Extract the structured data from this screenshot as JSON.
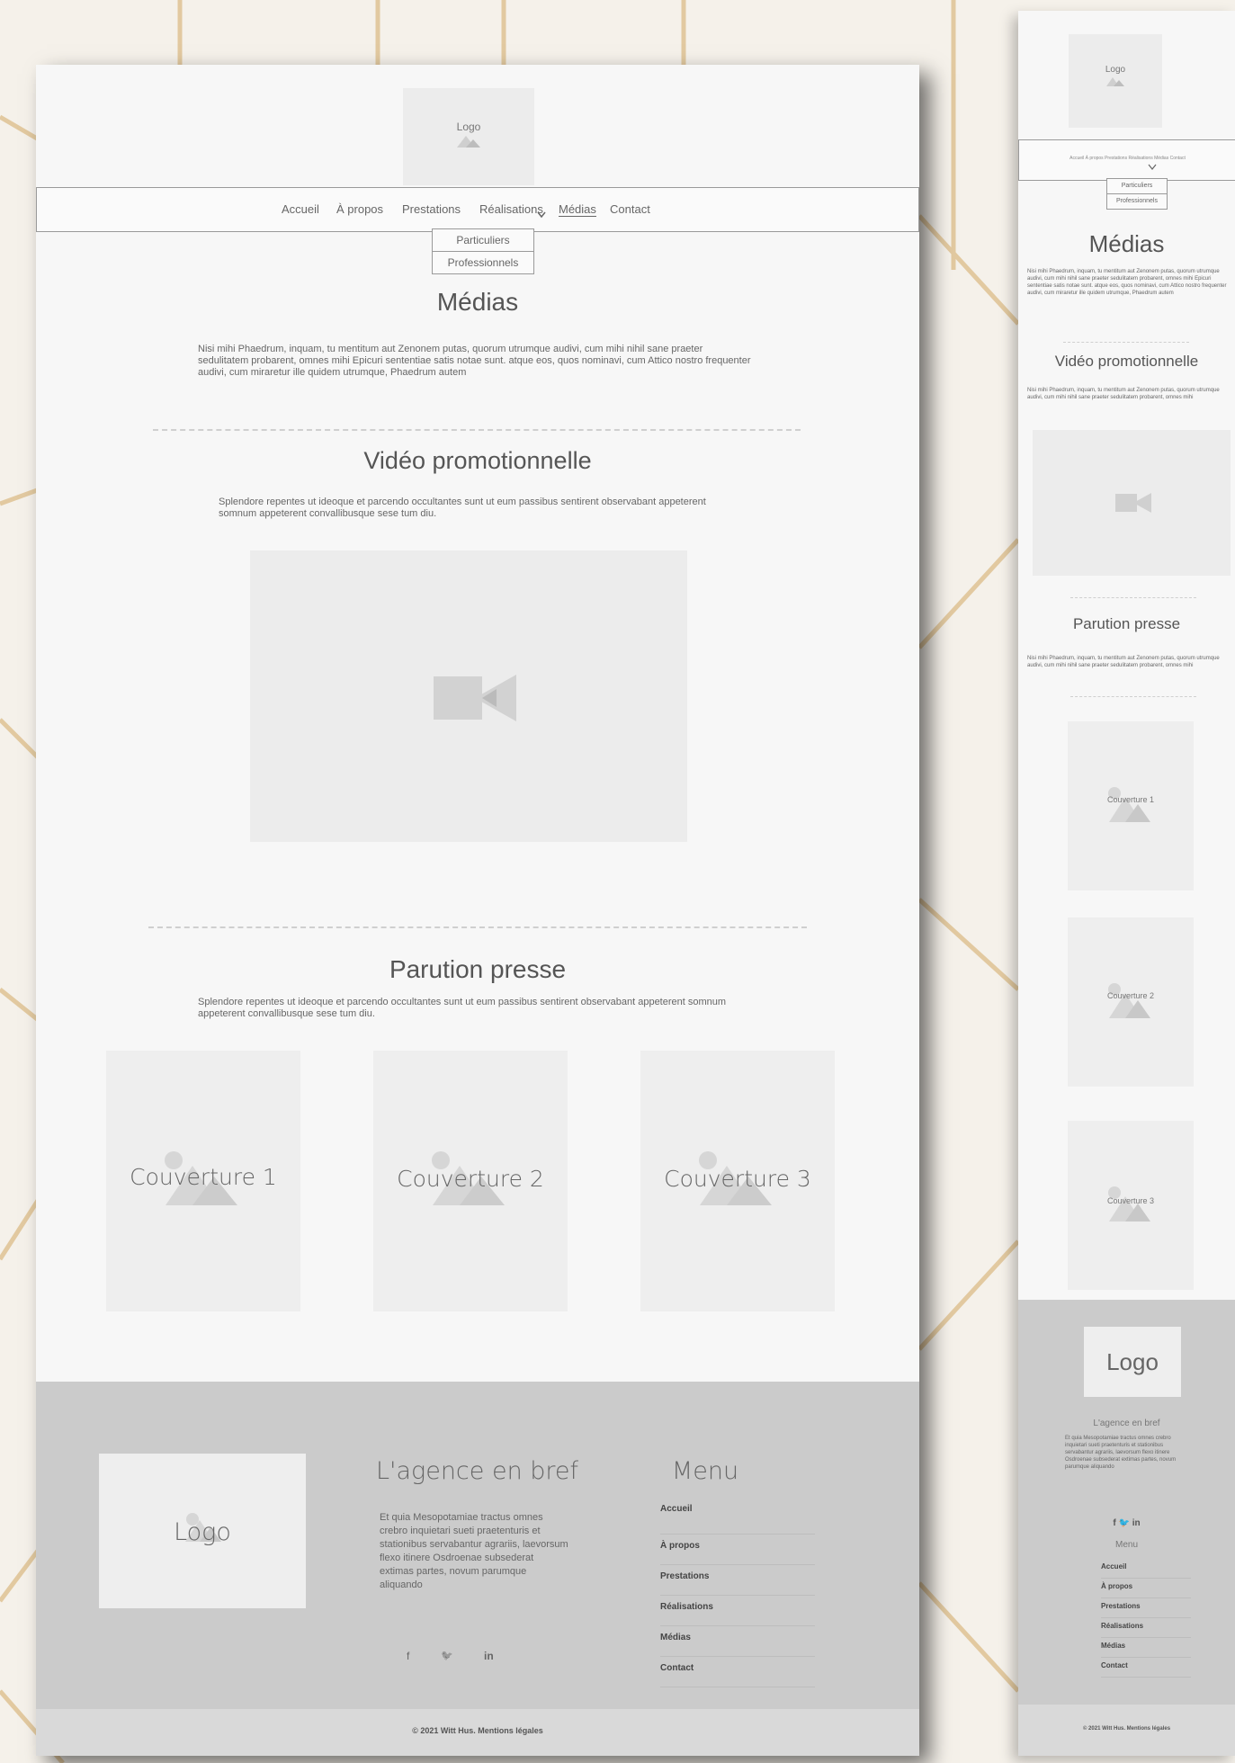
{
  "desktop": {
    "logo": "Logo",
    "nav": [
      "Accueil",
      "À propos",
      "Prestations",
      "Réalisations",
      "Médias",
      "Contact"
    ],
    "dropdown": [
      "Particuliers",
      "Professionnels"
    ],
    "title": "Médias",
    "intro": "Nisi mihi Phaedrum, inquam, tu mentitum aut Zenonem putas, quorum utrumque audivi, cum mihi nihil sane praeter sedulitatem probarent, omnes mihi Epicuri sententiae satis notae sunt. atque eos, quos nominavi, cum Attico nostro frequenter audivi, cum miraretur ille quidem utrumque, Phaedrum autem",
    "video_title": "Vidéo promotionnelle",
    "video_text": "Splendore repentes ut ideoque et parcendo occultantes sunt ut eum passibus sentirent observabant appeterent somnum appeterent convallibusque sese tum diu.",
    "press_title": "Parution presse",
    "press_text": "Splendore repentes ut ideoque et parcendo occultantes sunt ut eum passibus sentirent observabant appeterent somnum appeterent convallibusque sese tum diu.",
    "covers": [
      "Couverture 1",
      "Couverture 2",
      "Couverture 3"
    ],
    "footer": {
      "logo": "Logo",
      "about_title": "L'agence en bref",
      "about_text": "Et quia Mesopotamiae tractus omnes crebro inquietari sueti praetenturis et stationibus servabantur agrariis, laevorsum flexo itinere Osdroenae subsederat extimas partes, novum parumque aliquando",
      "social": [
        "f",
        "🐦",
        "in"
      ],
      "menu_title": "Menu",
      "menu": [
        "Accueil",
        "À propos",
        "Prestations",
        "Réalisations",
        "Médias",
        "Contact"
      ],
      "copyright": "© 2021 Witt Hus. Mentions légales"
    }
  },
  "mobile": {
    "logo": "Logo",
    "nav_text": "Accueil  À propos  Prestations  Réalisations  Médias  Contact",
    "dropdown": [
      "Particuliers",
      "Professionnels"
    ],
    "title": "Médias",
    "intro": "Nisi mihi Phaedrum, inquam, tu mentitum aut Zenonem putas, quorum utrumque audivi, cum mihi nihil sane praeter sedulitatem probarent, omnes mihi Epicuri sententiae satis notae sunt. atque eos, quos nominavi, cum Attico nostro frequenter audivi, cum miraretur ille quidem utrumque, Phaedrum autem",
    "video_title": "Vidéo promotionnelle",
    "video_text": "Nisi mihi Phaedrum, inquam, tu mentitum aut Zenonem putas, quorum utrumque audivi, cum mihi nihil sane praeter sedulitatem probarent, omnes mihi",
    "press_title": "Parution presse",
    "press_text": "Nisi mihi Phaedrum, inquam, tu mentitum aut Zenonem putas, quorum utrumque audivi, cum mihi nihil sane praeter sedulitatem probarent, omnes mihi",
    "covers": [
      "Couverture 1",
      "Couverture 2",
      "Couverture 3"
    ],
    "footer": {
      "logo": "Logo",
      "about_title": "L'agence en bref",
      "about_text": "Et quia Mesopotamiae tractus omnes crebro inquietari sueti praetenturis et stationibus servabantur agrariis, laevorsum flexo itinere Osdroenae subsederat extimas partes, novum parumque aliquando",
      "social": "f 🐦 in",
      "menu_title": "Menu",
      "menu": [
        "Accueil",
        "À propos",
        "Prestations",
        "Réalisations",
        "Médias",
        "Contact"
      ],
      "copyright": "© 2021 Witt Hus. Mentions légales"
    }
  },
  "colors": {
    "background": "#f5f1ea",
    "lines": "#e2c9a0",
    "footer": "#cbcbcb",
    "placeholder": "#ececec"
  },
  "icons": [
    "image-placeholder-icon",
    "video-camera-icon",
    "facebook-icon",
    "twitter-icon",
    "linkedin-icon",
    "chevron-down-icon"
  ]
}
